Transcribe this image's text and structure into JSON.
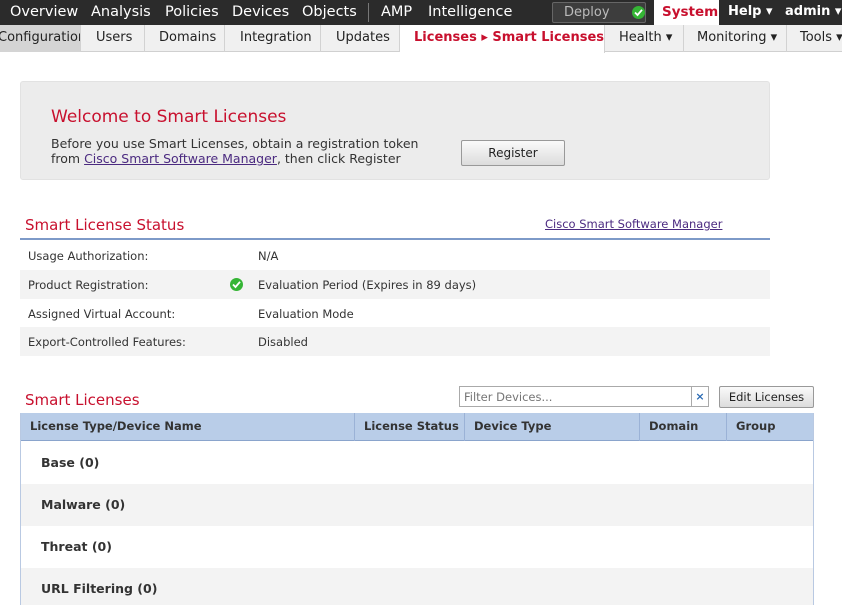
{
  "topnav": {
    "items": [
      "Overview",
      "Analysis",
      "Policies",
      "Devices",
      "Objects",
      "AMP",
      "Intelligence"
    ],
    "deploy_label": "Deploy",
    "system_label": "System",
    "help_label": "Help ▾",
    "user_label": "admin ▾",
    "status_color": "#35b535"
  },
  "subnav": {
    "tabs": [
      "Configuration",
      "Users",
      "Domains",
      "Integration",
      "Updates",
      "Licenses ▸ Smart Licenses",
      "Health ▾",
      "Monitoring ▾",
      "Tools ▾"
    ],
    "active_index": 5
  },
  "welcome": {
    "title": "Welcome to Smart Licenses",
    "line1": "Before you use Smart Licenses, obtain a registration token",
    "line2_prefix": "from ",
    "line2_link": "Cisco Smart Software Manager",
    "line2_suffix": ", then click Register",
    "register_label": "Register"
  },
  "status": {
    "title": "Smart License Status",
    "link": "Cisco Smart Software Manager",
    "rows": [
      {
        "label": "Usage Authorization:",
        "value": "N/A"
      },
      {
        "label": "Product Registration:",
        "value": "Evaluation Period (Expires in 89 days)"
      },
      {
        "label": "Assigned Virtual Account:",
        "value": "Evaluation Mode"
      },
      {
        "label": "Export-Controlled Features:",
        "value": "Disabled"
      }
    ]
  },
  "licenses": {
    "title": "Smart Licenses",
    "filter_placeholder": "Filter Devices...",
    "clear_label": "×",
    "edit_label": "Edit Licenses",
    "columns": [
      "License Type/Device Name",
      "License Status",
      "Device Type",
      "Domain",
      "Group"
    ],
    "rows": [
      "Base (0)",
      "Malware (0)",
      "Threat (0)",
      "URL Filtering (0)"
    ]
  },
  "colors": {
    "accent_red": "#c8102e",
    "link_purple": "#4b2a80",
    "table_header": "#b9cde8"
  }
}
